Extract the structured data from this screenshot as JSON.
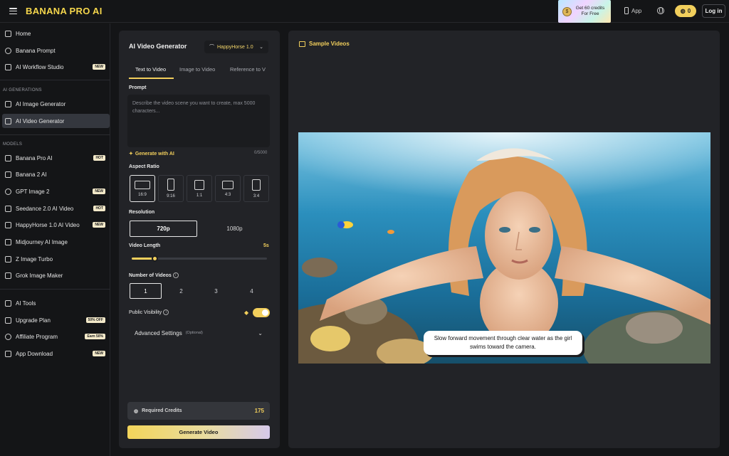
{
  "header": {
    "logo": "BANANA PRO AI",
    "promo_coin": "$",
    "promo_text": "Get 60 credits For Free",
    "app_label": "App",
    "credits": "0",
    "login_label": "Log in"
  },
  "sidebar": {
    "top_items": [
      {
        "label": "Home",
        "icon": "home-icon"
      },
      {
        "label": "Banana Prompt",
        "icon": "bulb-icon"
      },
      {
        "label": "AI Workflow Studio",
        "icon": "workflow-icon",
        "badge": "NEW"
      }
    ],
    "ai_generations_label": "AI GENERATIONS",
    "gen_items": [
      {
        "label": "AI Image Generator",
        "icon": "image-icon"
      },
      {
        "label": "AI Video Generator",
        "icon": "video-icon",
        "active": true
      }
    ],
    "models_label": "MODELS",
    "models": [
      {
        "label": "Banana Pro AI",
        "icon": "banana-icon",
        "badge": "HOT"
      },
      {
        "label": "Banana 2 AI",
        "icon": "banana-icon"
      },
      {
        "label": "GPT Image 2",
        "icon": "gpt-icon",
        "badge": "NEW"
      },
      {
        "label": "Seedance 2.0 AI Video",
        "icon": "seedance-icon",
        "badge": "HOT"
      },
      {
        "label": "HappyHorse 1.0 AI Video",
        "icon": "horse-icon",
        "badge": "NEW"
      },
      {
        "label": "Midjourney AI Image",
        "icon": "midjourney-icon"
      },
      {
        "label": "Z Image Turbo",
        "icon": "z-icon"
      },
      {
        "label": "Grok Image Maker",
        "icon": "grok-icon"
      }
    ],
    "bottom_items": [
      {
        "label": "AI Tools",
        "icon": "tools-icon"
      },
      {
        "label": "Upgrade Plan",
        "icon": "diamond-icon",
        "badge": "50% OFF"
      },
      {
        "label": "Affiliate Program",
        "icon": "affiliate-icon",
        "badge": "Earn 50%"
      },
      {
        "label": "App Download",
        "icon": "phone-icon",
        "badge": "NEW"
      }
    ]
  },
  "generator": {
    "title": "AI Video Generator",
    "model": "HappyHorse 1.0",
    "tabs": [
      "Text to Video",
      "Image to Video",
      "Reference to V"
    ],
    "prompt_label": "Prompt",
    "prompt_placeholder": "Describe the video scene you want to create, max 5000 characters...",
    "generate_ai_label": "Generate with AI",
    "char_count": "0/5000",
    "aspect_label": "Aspect Ratio",
    "aspect_ratios": [
      "16:9",
      "9:16",
      "1:1",
      "4:3",
      "3:4"
    ],
    "selected_aspect": "16:9",
    "resolution_label": "Resolution",
    "resolutions": [
      "720p",
      "1080p"
    ],
    "selected_resolution": "720p",
    "length_label": "Video Length",
    "length_value": "5s",
    "length_fraction": 0.17,
    "num_label": "Number of Videos",
    "num_options": [
      "1",
      "2",
      "3",
      "4"
    ],
    "selected_num": "1",
    "visibility_label": "Public Visibility",
    "visibility_on": true,
    "advanced_label": "Advanced Settings",
    "advanced_optional": "(Optional)",
    "required_credits_label": "Required Credits",
    "required_credits_value": "175",
    "generate_label": "Generate Video"
  },
  "sample": {
    "title": "Sample Videos",
    "caption": "Slow forward movement through clear water as the girl swims toward the camera."
  },
  "colors": {
    "accent": "#f2cf5c",
    "panel": "#222327",
    "background": "#141517"
  }
}
